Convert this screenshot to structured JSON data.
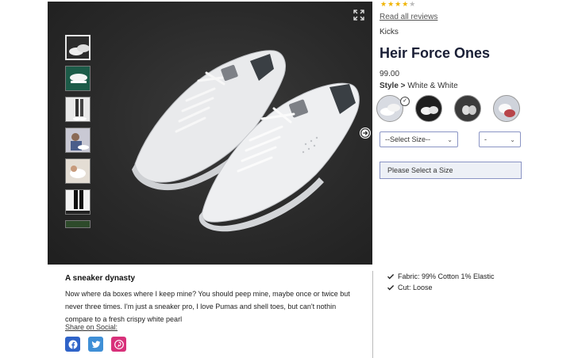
{
  "rating": {
    "filled": 4,
    "total": 5,
    "stars_filled": "★★★★",
    "stars_empty": "★"
  },
  "reviews_link": "Read all reviews",
  "brand": "Kicks",
  "product_title": "Heir Force Ones",
  "price": "99.00",
  "style": {
    "label": "Style >",
    "value": "White & White"
  },
  "size_select": {
    "value": "--Select Size--"
  },
  "qty_select": {
    "value": "-"
  },
  "add_button_label": "Please Select a Size",
  "description": {
    "title": "A sneaker dynasty",
    "body": "Now where da boxes where I keep mine? You should peep mine, maybe once or twice but never three times. I'm just a sneaker pro, I love Pumas and shell toes, but can't nothin compare to a fresh crispy white pearl"
  },
  "share_label": "Share on Social:",
  "features": [
    "Fabric: 99% Cotton 1% Elastic",
    "Cut: Loose"
  ],
  "colors": {
    "star": "#f0b400",
    "facebook": "#2f63c8",
    "twitter": "#3f8fd6",
    "pinterest": "#d8317a",
    "title": "#1a1f36"
  }
}
